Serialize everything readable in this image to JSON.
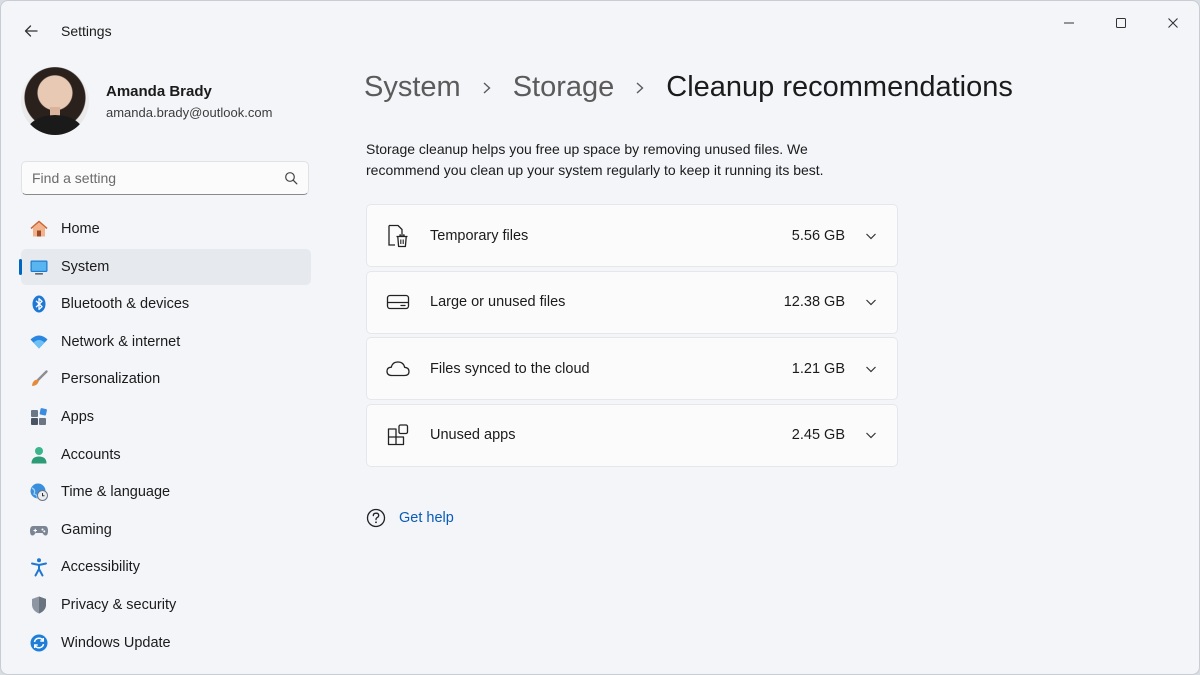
{
  "window": {
    "title": "Settings"
  },
  "profile": {
    "name": "Amanda Brady",
    "email": "amanda.brady@outlook.com"
  },
  "search": {
    "placeholder": "Find a setting"
  },
  "sidebar": {
    "items": [
      {
        "label": "Home",
        "icon": "home-icon"
      },
      {
        "label": "System",
        "icon": "system-icon",
        "active": true
      },
      {
        "label": "Bluetooth & devices",
        "icon": "bluetooth-icon"
      },
      {
        "label": "Network & internet",
        "icon": "wifi-icon"
      },
      {
        "label": "Personalization",
        "icon": "brush-icon"
      },
      {
        "label": "Apps",
        "icon": "apps-icon"
      },
      {
        "label": "Accounts",
        "icon": "account-icon"
      },
      {
        "label": "Time & language",
        "icon": "globe-clock-icon"
      },
      {
        "label": "Gaming",
        "icon": "controller-icon"
      },
      {
        "label": "Accessibility",
        "icon": "accessibility-icon"
      },
      {
        "label": "Privacy & security",
        "icon": "shield-icon"
      },
      {
        "label": "Windows Update",
        "icon": "update-icon"
      }
    ]
  },
  "breadcrumb": [
    "System",
    "Storage",
    "Cleanup recommendations"
  ],
  "description": "Storage cleanup helps you free up space by removing unused files. We recommend you clean up your system regularly to keep it running its best.",
  "cleanup": [
    {
      "label": "Temporary files",
      "size": "5.56 GB",
      "icon": "trash-file-icon"
    },
    {
      "label": "Large or unused files",
      "size": "12.38 GB",
      "icon": "drive-icon"
    },
    {
      "label": "Files synced to the cloud",
      "size": "1.21 GB",
      "icon": "cloud-icon"
    },
    {
      "label": "Unused apps",
      "size": "2.45 GB",
      "icon": "apps-grid-icon"
    }
  ],
  "help": {
    "label": "Get help"
  },
  "colors": {
    "accent": "#0067c0",
    "link": "#0a5bb5",
    "background": "#f3f5f9"
  }
}
